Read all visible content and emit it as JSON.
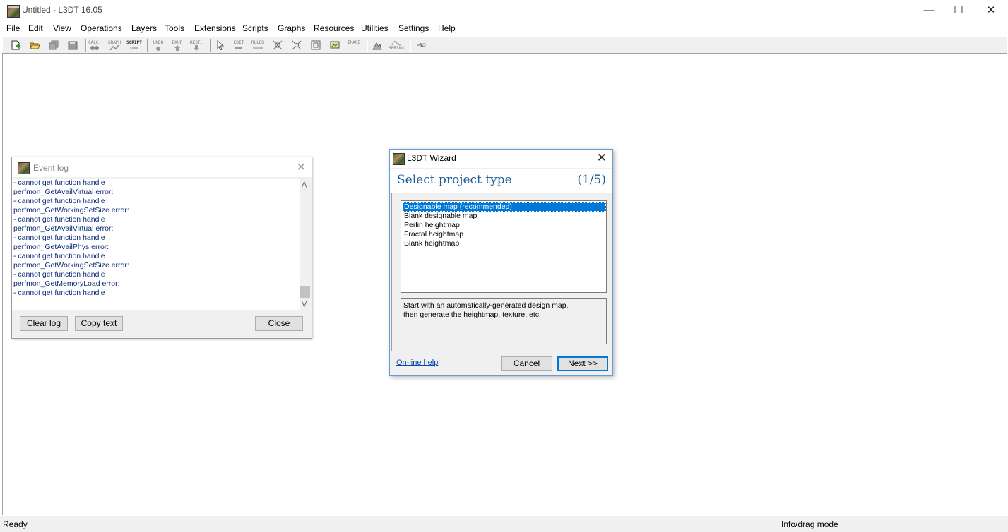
{
  "window": {
    "title": "Untitled - L3DT 16.05",
    "minimize": "—",
    "maximize": "☐",
    "close": "✕"
  },
  "menu": [
    "File",
    "Edit",
    "View",
    "Operations",
    "Layers",
    "Tools",
    "Extensions",
    "Scripts",
    "Graphs",
    "Resources",
    "Utilities",
    "Settings",
    "Help"
  ],
  "toolbar": {
    "labels": [
      {
        "id": "calc",
        "text": "CALC."
      },
      {
        "id": "graph",
        "text": "GRAPH"
      },
      {
        "id": "script",
        "text": "SCRIPT"
      },
      {
        "id": "undo",
        "text": "UNDO"
      },
      {
        "id": "bkup",
        "text": "BKUP"
      },
      {
        "id": "rest",
        "text": "REST."
      },
      {
        "id": "edit",
        "text": "EDIT"
      },
      {
        "id": "ruler",
        "text": "RULER"
      },
      {
        "id": "image",
        "text": "IMAGE"
      },
      {
        "id": "spring",
        "text": "SPRING"
      }
    ]
  },
  "status": {
    "left": "Ready",
    "right": "Info/drag mode"
  },
  "event_log": {
    "title": "Event log",
    "lines": [
      " - cannot get function handle",
      "perfmon_GetAvailVirtual error:",
      " - cannot get function handle",
      "perfmon_GetWorkingSetSize error:",
      " - cannot get function handle",
      "perfmon_GetAvailVirtual error:",
      " - cannot get function handle",
      "perfmon_GetAvailPhys error:",
      " - cannot get function handle",
      "perfmon_GetWorkingSetSize error:",
      " - cannot get function handle",
      "perfmon_GetMemoryLoad error:",
      " - cannot get function handle"
    ],
    "buttons": {
      "clear": "Clear log",
      "copy": "Copy text",
      "close": "Close"
    }
  },
  "wizard": {
    "title": "L3DT Wizard",
    "heading": "Select project type",
    "step": "(1/5)",
    "options": [
      {
        "label": "Designable map (recommended)",
        "selected": true
      },
      {
        "label": "Blank designable map",
        "selected": false
      },
      {
        "label": "Perlin heightmap",
        "selected": false
      },
      {
        "label": "Fractal heightmap",
        "selected": false
      },
      {
        "label": "Blank heightmap",
        "selected": false
      }
    ],
    "description": [
      "Start with an automatically-generated design map,",
      "then generate the heightmap, texture, etc."
    ],
    "help_link": "On-line help",
    "cancel": "Cancel",
    "next": "Next >>"
  },
  "colors": {
    "accent": "#0078d7",
    "heading": "#1b5e96",
    "log_text": "#0c2c78",
    "link": "#0645ad"
  }
}
